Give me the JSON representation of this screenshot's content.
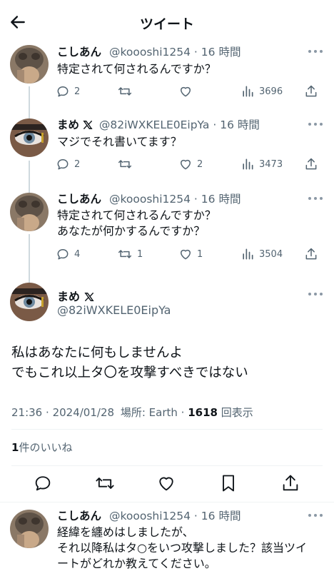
{
  "header": {
    "title": "ツイート"
  },
  "tweets": [
    {
      "name": "こしあん",
      "handle": "@koooshi1254",
      "dot": "·",
      "time": "16 時間",
      "lines": [
        "特定されて何されるんですか？"
      ],
      "reply": "2",
      "retweet": "",
      "like": "",
      "views": "3696"
    },
    {
      "name": "まめ",
      "name_icon": "apple-icon",
      "badge": "x-logo-icon",
      "handle": "@82iWXKELE0EipYa",
      "dot": "·",
      "time": "16 時間",
      "lines": [
        "マジでそれ書いてます？"
      ],
      "reply": "2",
      "retweet": "",
      "like": "2",
      "views": "3473"
    },
    {
      "name": "こしあん",
      "handle": "@koooshi1254",
      "dot": "·",
      "time": "16 時間",
      "lines": [
        "特定されて何されるんですか？",
        "あなたが何かするんですか？"
      ],
      "reply": "4",
      "retweet": "1",
      "like": "1",
      "views": "3504"
    }
  ],
  "main_tweet": {
    "name": "まめ",
    "name_icon": "apple-icon",
    "badge": "x-logo-icon",
    "handle": "@82iWXKELE0EipYa",
    "lines": [
      "私はあなたに何もしませんよ",
      "でもこれ以上タ〇を攻撃すべきではない"
    ],
    "time": "21:36",
    "dot": "·",
    "date": "2024/01/28",
    "location_label": "場所: Earth",
    "view_count": "1618",
    "view_label": "回表示",
    "like_count": "1",
    "like_label": "件のいいね"
  },
  "reply_tweet": {
    "name": "こしあん",
    "handle": "@koooshi1254",
    "dot": "·",
    "time": "16 時間",
    "lines": [
      "経緯を纏めはしましたが、",
      "それ以降私はタ○をいつ攻撃しました？該当ツイ",
      "ートがどれか教えてください。"
    ]
  },
  "colors": {
    "text": "#0f1419",
    "secondary": "#536471",
    "line": "#cfd9de",
    "divider": "#eff3f4"
  }
}
